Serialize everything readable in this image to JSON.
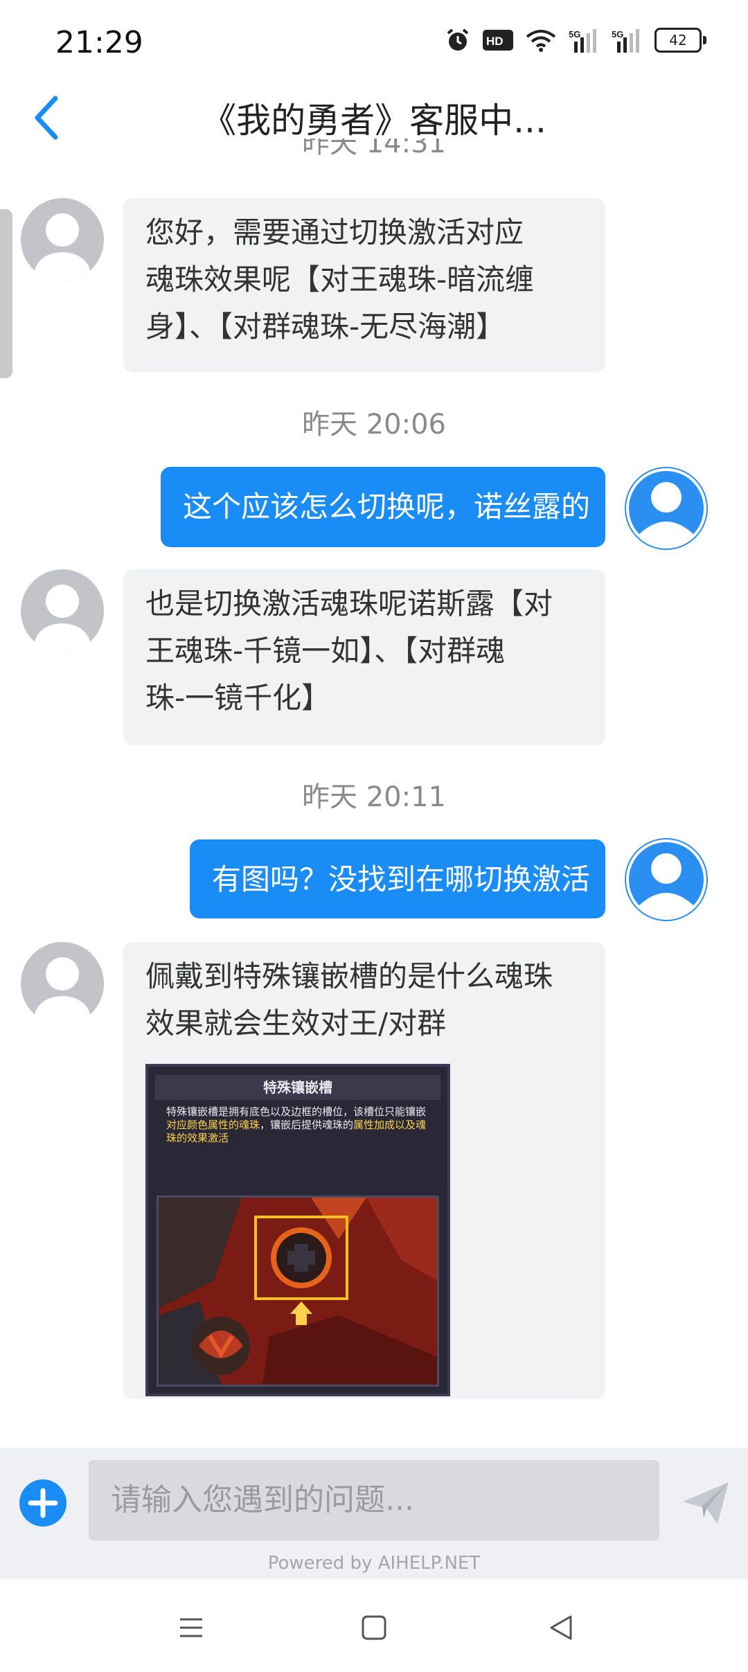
{
  "status_bar": {
    "time": "21:29",
    "battery": "42",
    "icons": [
      "alarm-icon",
      "hd-icon",
      "wifi-icon",
      "signal-5g-icon",
      "signal-5g-icon",
      "battery-icon"
    ]
  },
  "header": {
    "title": "《我的勇者》客服中..."
  },
  "messages": {
    "partial_timestamp": "昨天 14:31",
    "msg1": {
      "lines": [
        "您好，需要通过切换激活对应",
        "魂珠效果呢【对王魂珠-暗流缠",
        "身】、【对群魂珠-无尽海潮】"
      ]
    },
    "ts2": "昨天 20:06",
    "msg2": {
      "text": "这个应该怎么切换呢，诺丝露的"
    },
    "msg3": {
      "lines": [
        "也是切换激活魂珠呢诺斯露【对",
        "王魂珠-千镜一如】、【对群魂",
        "珠-一镜千化】"
      ]
    },
    "ts3": "昨天 20:11",
    "msg4": {
      "text": "有图吗？没找到在哪切换激活"
    },
    "msg5": {
      "lines": [
        "佩戴到特殊镶嵌槽的是什么魂珠",
        "效果就会生效对王/对群"
      ],
      "image": {
        "title": "特殊镶嵌槽",
        "desc_1": "特殊镶嵌槽是拥有底色以及边框的槽位，该槽位只能镶嵌",
        "desc_hl1": "对应颜色属性的魂珠",
        "desc_2": "，镶嵌后提供魂珠的",
        "desc_hl2": "属性加成以及魂珠的效果激活"
      }
    }
  },
  "input": {
    "placeholder": "请输入您遇到的问题...",
    "powered_by": "Powered by AIHELP.NET"
  },
  "colors": {
    "accent": "#1a8cf6",
    "agent_bubble": "#f1f2f4",
    "timestamp": "#8a8a8a"
  }
}
